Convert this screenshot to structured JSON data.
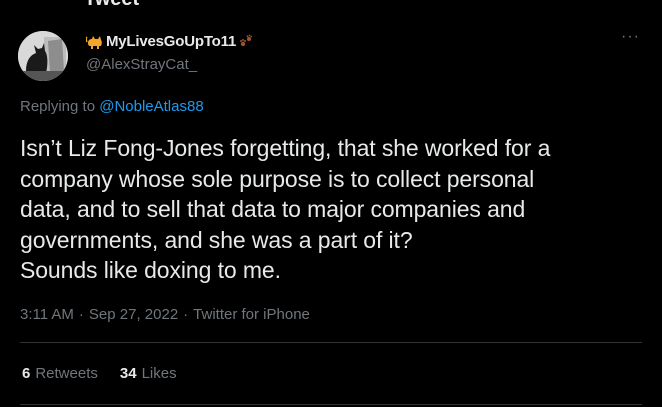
{
  "page": {
    "cut_header": "Tweet"
  },
  "author": {
    "display_name": "MyLivesGoUpTo11",
    "handle": "@AlexStrayCat_",
    "leading_emoji": "cat-emoji",
    "trailing_emoji": "paw-prints-emoji"
  },
  "more_label": "···",
  "reply": {
    "prefix": "Replying to",
    "mention": "@NobleAtlas88"
  },
  "tweet": {
    "text": "Isn’t Liz Fong-Jones forgetting, that she worked for a\ncompany whose sole purpose is to collect personal\ndata, and to sell that data to major companies and\ngovernments, and she was a part of it?\nSounds like doxing to me.",
    "time": "3:11 AM",
    "date": "Sep 27, 2022",
    "source": "Twitter for iPhone",
    "sep": "·"
  },
  "stats": {
    "retweets_count": "6",
    "retweets_label": "Retweets",
    "likes_count": "34",
    "likes_label": "Likes"
  },
  "colors": {
    "background": "#000000",
    "text": "#e7e9ea",
    "muted": "#71767b",
    "link": "#1d9bf0",
    "divider": "#2f3336"
  }
}
